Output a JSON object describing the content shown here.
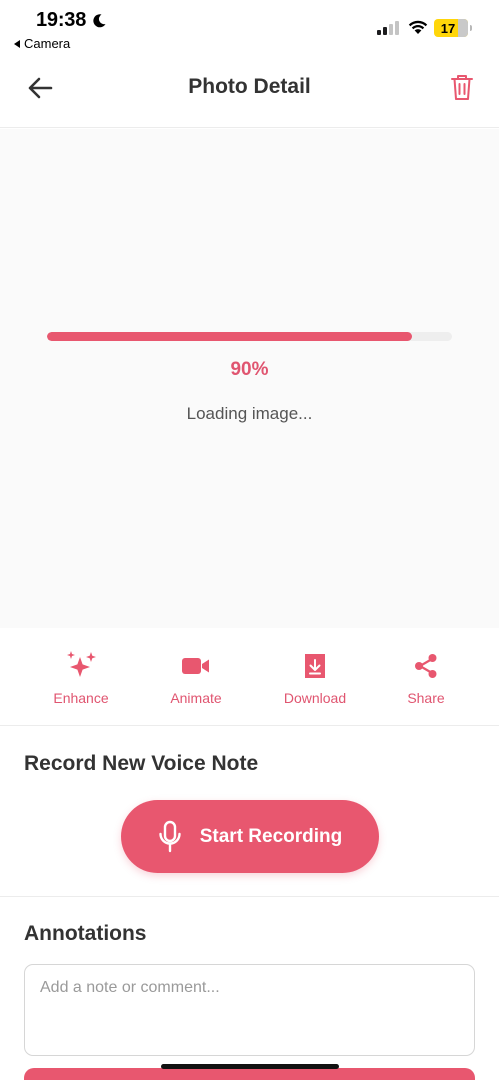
{
  "status_bar": {
    "time": "19:38",
    "back_app": "Camera",
    "battery": "17"
  },
  "header": {
    "title": "Photo Detail"
  },
  "loading": {
    "progress": 0.9,
    "percent_label": "90%",
    "message": "Loading image..."
  },
  "actions": [
    {
      "label": "Enhance",
      "icon": "sparkles-icon"
    },
    {
      "label": "Animate",
      "icon": "video-camera-icon"
    },
    {
      "label": "Download",
      "icon": "download-icon"
    },
    {
      "label": "Share",
      "icon": "share-icon"
    }
  ],
  "voice_note": {
    "title": "Record New Voice Note",
    "button_label": "Start Recording"
  },
  "annotations": {
    "title": "Annotations",
    "placeholder": "Add a note or comment...",
    "value": ""
  },
  "colors": {
    "accent": "#e8576f",
    "accent_text": "#e05570",
    "battery": "#ffd60a"
  }
}
